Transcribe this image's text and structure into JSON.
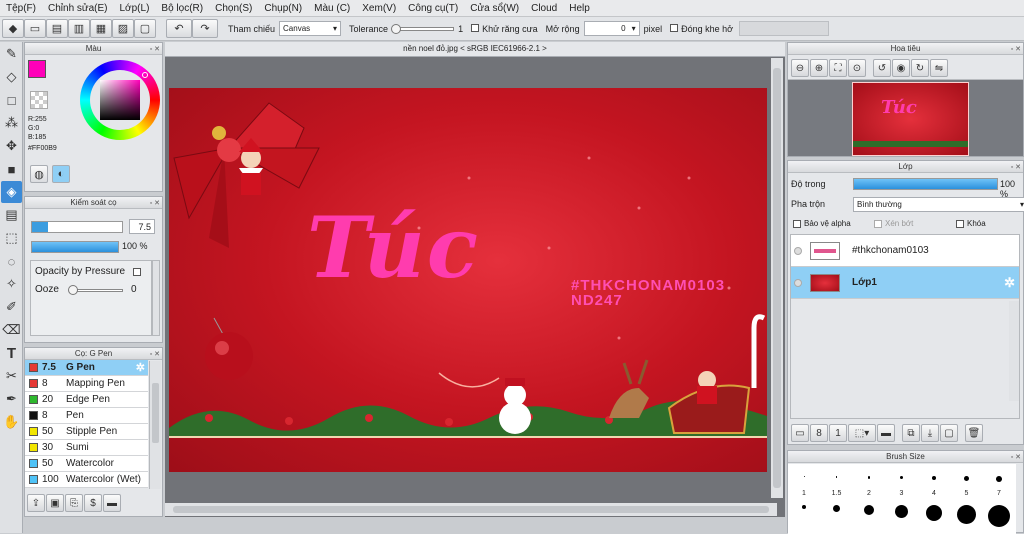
{
  "menu": [
    "Tệp(F)",
    "Chỉnh sửa(E)",
    "Lớp(L)",
    "Bộ lọc(R)",
    "Chọn(S)",
    "Chụp(N)",
    "Màu (C)",
    "Xem(V)",
    "Công cụ(T)",
    "Cửa sổ(W)",
    "Cloud",
    "Help"
  ],
  "toolbar": {
    "tham_chieu": "Tham chiếu",
    "canvas": "Canvas",
    "tolerance": "Tolerance",
    "tolerance_value": "1",
    "khu_rang_cua": "Khử răng cưa",
    "mo_rong": "Mở rộng",
    "mo_rong_value": "0",
    "pixel": "pixel",
    "dong_khe_ho": "Đóng khe hở"
  },
  "color_panel": {
    "title": "Màu",
    "r": "R:255",
    "g": "G:0",
    "b": "B:185",
    "hex": "#FF00B9",
    "color": "#ff00b9"
  },
  "brush_control": {
    "title": "Kiểm soát cọ",
    "size": "7.5",
    "opacity": "100 %",
    "opacity_by_pressure": "Opacity by Pressure",
    "ooze": "Ooze",
    "ooze_value": "0"
  },
  "brush_panel": {
    "title": "Cọ: G Pen",
    "items": [
      {
        "size": "7.5",
        "name": "G Pen",
        "color": "#e53935"
      },
      {
        "size": "8",
        "name": "Mapping Pen",
        "color": "#e53935"
      },
      {
        "size": "20",
        "name": "Edge Pen",
        "color": "#2eb82e"
      },
      {
        "size": "8",
        "name": "Pen",
        "color": "#111111"
      },
      {
        "size": "50",
        "name": "Stipple Pen",
        "color": "#f2e600"
      },
      {
        "size": "30",
        "name": "Sumi",
        "color": "#f2e600"
      },
      {
        "size": "50",
        "name": "Watercolor",
        "color": "#4fc3f7"
      },
      {
        "size": "100",
        "name": "Watercolor (Wet)",
        "color": "#4fc3f7"
      }
    ]
  },
  "document": {
    "tab": "nền noel đỏ.jpg < sRGB IEC61966-2.1 >",
    "title_text": "Túc",
    "hashtag_1": "#THKCHONAM0103",
    "hashtag_2": "ND247"
  },
  "navigator": {
    "title": "Hoa tiêu"
  },
  "layers": {
    "title": "Lớp",
    "opacity_label": "Độ trong",
    "opacity_value": "100 %",
    "opacity_fraction": 1.0,
    "blend_label": "Pha trộn",
    "blend_value": "Bình thường",
    "protect_alpha": "Bảo vệ alpha",
    "clipping": "Xén bớt",
    "lock": "Khóa",
    "items": [
      {
        "name": "#thkchonam0103"
      },
      {
        "name": "Lớp1"
      }
    ]
  },
  "brush_size": {
    "title": "Brush Size",
    "sizes": [
      "1",
      "1.5",
      "2",
      "3",
      "4",
      "5",
      "7"
    ]
  }
}
